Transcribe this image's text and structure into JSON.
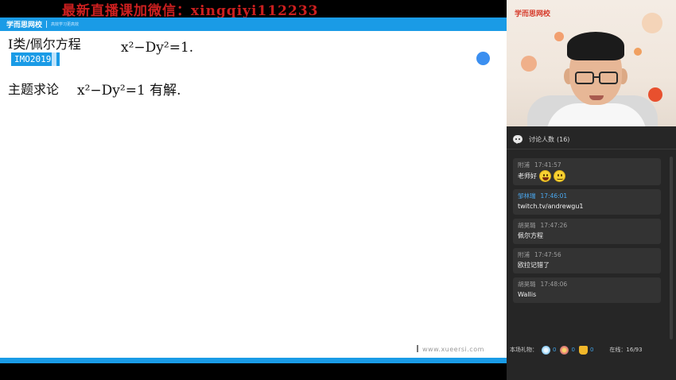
{
  "watermark": "最新直播课加微信：xingqiyi112233",
  "brand": {
    "name": "学而思网校",
    "slogan": "高效学习更高效"
  },
  "board": {
    "line1_left": "I类/佩尔方程",
    "line1_right": "x²−Dy²=1.",
    "tag": "IMO2019",
    "line2_left": "主题求论",
    "line2_right": "x²−Dy²=1 有解.",
    "site_url": "www.xueersi.com"
  },
  "video": {
    "logo": "学而思网校"
  },
  "chat": {
    "header": "讨论人数",
    "count": "(16)",
    "messages": [
      {
        "user": "附浦",
        "time": "17:41:57",
        "text": "老师好",
        "emojis": [
          "grin",
          "smile"
        ],
        "highlight": false
      },
      {
        "user": "邹林瑞",
        "time": "17:46:01",
        "text": "twitch.tv/andrewgu1",
        "emojis": [],
        "highlight": true
      },
      {
        "user": "胡昊璐",
        "time": "17:47:26",
        "text": "佩尔方程",
        "emojis": [],
        "highlight": false
      },
      {
        "user": "附浦",
        "time": "17:47:56",
        "text": "欧拉记错了",
        "emojis": [],
        "highlight": false
      },
      {
        "user": "胡昊璐",
        "time": "17:48:06",
        "text": "Wallis",
        "emojis": [],
        "highlight": false
      }
    ]
  },
  "footer": {
    "gifts_label": "本场礼物：",
    "gifts": [
      {
        "icon": "snowflake-icon",
        "count": "0"
      },
      {
        "icon": "flower-icon",
        "count": "0"
      },
      {
        "icon": "trophy-icon",
        "count": "0"
      }
    ],
    "online_label": "在线：",
    "online_value": "16/93"
  },
  "colors": {
    "brand_blue": "#1a9be6",
    "watermark_red": "#cc1f1f",
    "highlight_user": "#4aa8f0"
  }
}
